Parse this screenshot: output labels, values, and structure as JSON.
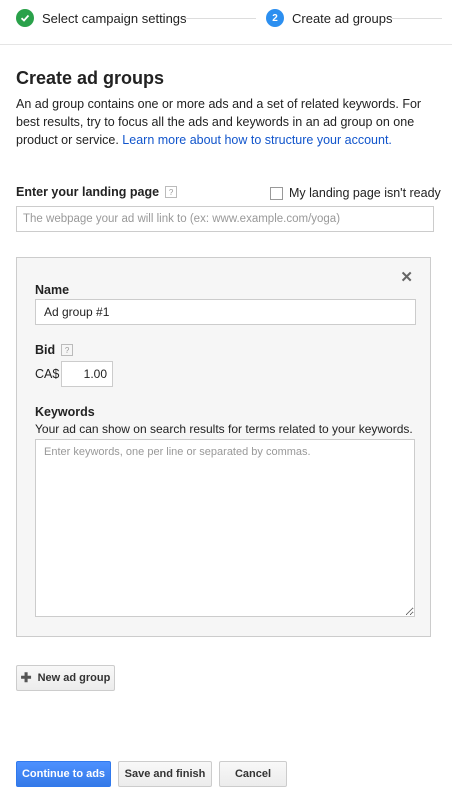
{
  "stepper": {
    "step1_label": "Select campaign settings",
    "step2_number": "2",
    "step2_label": "Create ad groups"
  },
  "page": {
    "title": "Create ad groups",
    "intro_text": "An ad group contains one or more ads and a set of related keywords. For best results, try to focus all the ads and keywords in an ad group on one product or service. ",
    "intro_link": "Learn more about how to structure your account."
  },
  "landing_page": {
    "label": "Enter your landing page",
    "help": "?",
    "checkbox_label": "My landing page isn't ready",
    "placeholder": "The webpage your ad will link to (ex: www.example.com/yoga)",
    "value": ""
  },
  "ad_group": {
    "close": "✕",
    "name_label": "Name",
    "name_value": "Ad group #1",
    "bid_label": "Bid",
    "bid_help": "?",
    "currency": "CA$",
    "bid_value": "1.00",
    "keywords_label": "Keywords",
    "keywords_help": "Your ad can show on search results for terms related to your keywords.",
    "keywords_placeholder": "Enter keywords, one per line or separated by commas."
  },
  "actions": {
    "new_ad_group": "New ad group",
    "continue": "Continue to ads",
    "save": "Save and finish",
    "cancel": "Cancel"
  },
  "colors": {
    "accent": "#2c8ff0",
    "complete": "#2aa14a",
    "link": "#1155cc"
  }
}
